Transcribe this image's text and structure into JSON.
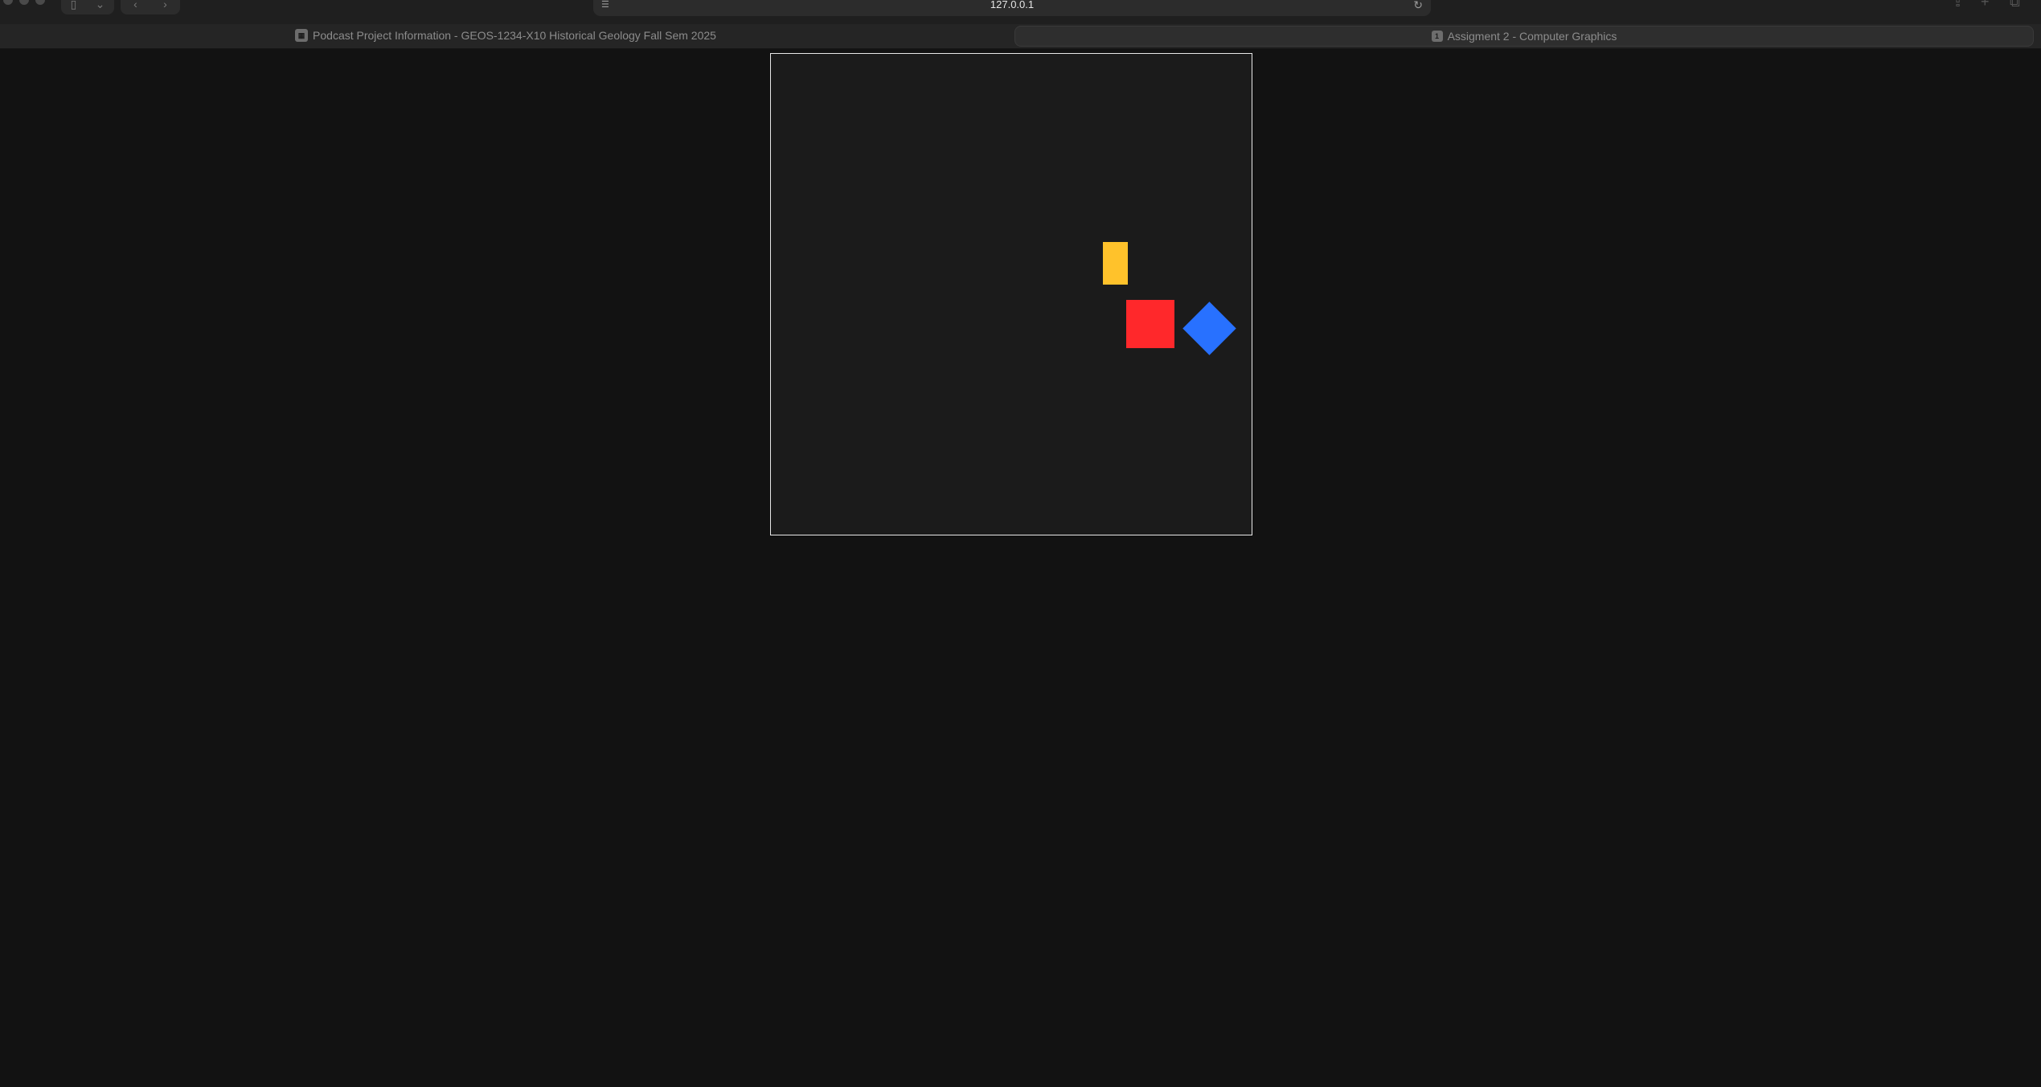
{
  "browser": {
    "url": "127.0.0.1",
    "icons": {
      "sidebar": "sidebar-icon",
      "chevron": "chevron-down-icon",
      "back": "chevron-left-icon",
      "forward": "chevron-right-icon",
      "page_settings": "page-settings-icon",
      "reload": "reload-icon",
      "share": "share-icon",
      "new_tab": "plus-icon",
      "tab_overview": "tab-overview-icon"
    }
  },
  "tabs": [
    {
      "title": "Podcast Project Information - GEOS-1234-X10 Historical Geology Fall Sem 2025",
      "favicon": "course-icon",
      "active": false
    },
    {
      "title": "Assigment 2 - Computer Graphics",
      "favicon": "1",
      "active": true
    }
  ],
  "canvas": {
    "shapes": [
      {
        "name": "yellow-rectangle",
        "color": "#ffc22b"
      },
      {
        "name": "red-square",
        "color": "#ff282b"
      },
      {
        "name": "blue-diamond",
        "color": "#2871ff"
      }
    ],
    "background": "#1b1b1b",
    "border_color": "#e8e8e8"
  },
  "colors": {
    "page_background": "#121212",
    "toolbar": "#1f1f1f",
    "tabbar": "#252525"
  }
}
